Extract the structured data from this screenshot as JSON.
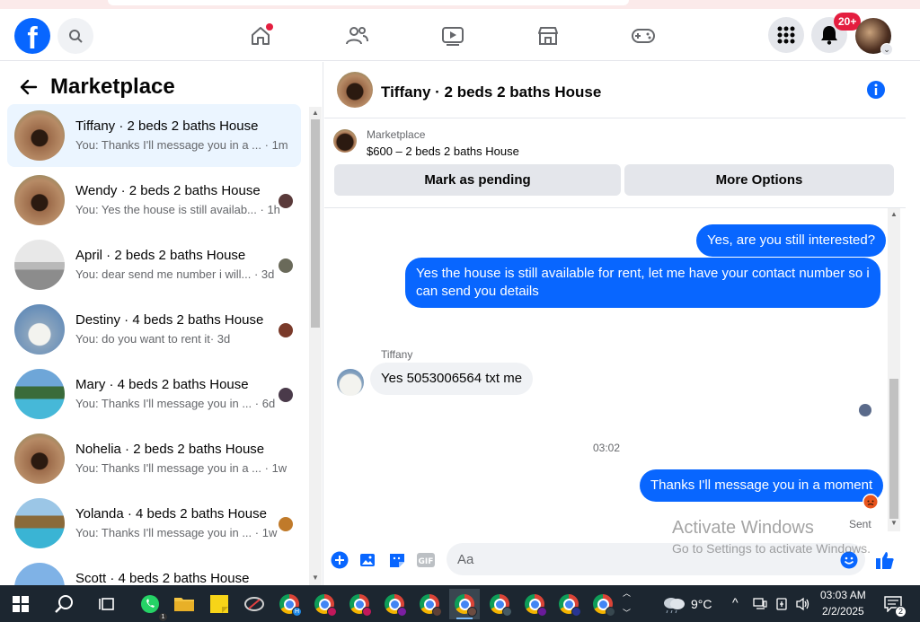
{
  "header": {
    "logo": "facebook-logo",
    "notification_badge": "20+",
    "nav": [
      "home",
      "friends",
      "watch",
      "marketplace",
      "gaming"
    ]
  },
  "sidebar": {
    "title": "Marketplace",
    "conversations": [
      {
        "name": "Tiffany · 2 beds 2 baths House",
        "preview": "You: Thanks I'll message you in a ...",
        "time": "· 1m",
        "active": true
      },
      {
        "name": "Wendy · 2 beds 2 baths House",
        "preview": "You: Yes the house is still availab...",
        "time": "· 1h"
      },
      {
        "name": "April · 2 beds 2 baths House",
        "preview": "You: dear send me number i will...",
        "time": "· 3d"
      },
      {
        "name": "Destiny · 4 beds 2 baths House",
        "preview": "You: do you want to rent it",
        "time": "· 3d"
      },
      {
        "name": "Mary · 4 beds 2 baths House",
        "preview": "You: Thanks I'll message you in ...",
        "time": "· 6d"
      },
      {
        "name": "Nohelia · 2 beds 2 baths House",
        "preview": "You: Thanks I'll message you in a ...",
        "time": "· 1w"
      },
      {
        "name": "Yolanda · 4 beds 2 baths House",
        "preview": "You: Thanks I'll message you in ...",
        "time": "· 1w"
      },
      {
        "name": "Scott · 4 beds 2 baths House",
        "preview": "",
        "time": ""
      }
    ]
  },
  "chat": {
    "title": "Tiffany · 2 beds 2 baths House",
    "listing_source": "Marketplace",
    "listing_price": "$600 – 2 beds 2 baths House",
    "mark_pending": "Mark as pending",
    "more_options": "More Options",
    "messages": {
      "m1": "Yes, are you still interested?",
      "m2": "Yes the house is still available for rent, let me have your contact number so i can send you details",
      "sender": "Tiffany",
      "m3": "Yes 5053006564 txt me",
      "timestamp": "03:02",
      "m4": "Thanks I'll message you in a moment",
      "status": "Sent"
    },
    "composer_placeholder": "Aa"
  },
  "watermark": {
    "line1": "Activate Windows",
    "line2": "Go to Settings to activate Windows."
  },
  "taskbar": {
    "weather": "9°C",
    "time": "03:03 AM",
    "date": "2/2/2025",
    "notifications": "2"
  },
  "colors": {
    "brand": "#0866ff",
    "badge": "#e41e3f",
    "active_row": "#ebf5ff"
  }
}
